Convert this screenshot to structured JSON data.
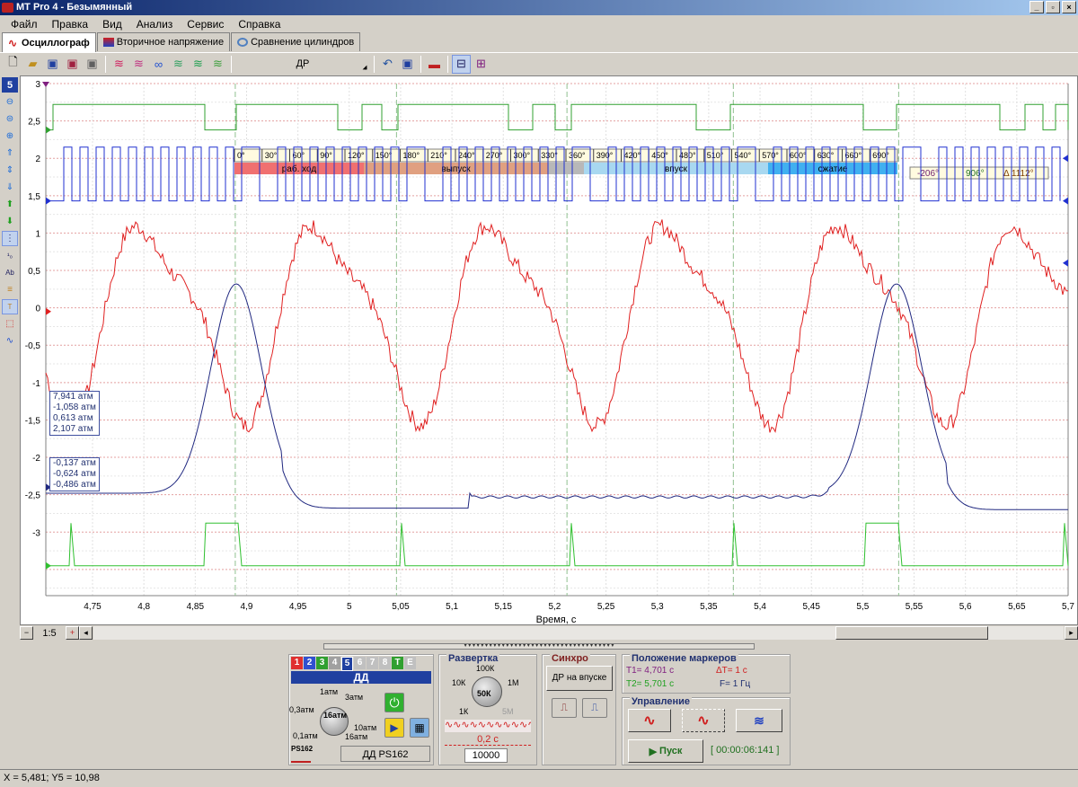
{
  "window": {
    "title": "MT Pro 4 - Безымянный",
    "min": "_",
    "max": "▫",
    "close": "×"
  },
  "menu": [
    "Файл",
    "Правка",
    "Вид",
    "Анализ",
    "Сервис",
    "Справка"
  ],
  "tabs": [
    {
      "label": "Осциллограф",
      "icon": "oscilloscope-icon"
    },
    {
      "label": "Вторичное напряжение",
      "icon": "secondary-voltage-icon"
    },
    {
      "label": "Сравнение цилиндров",
      "icon": "cylinders-compare-icon"
    }
  ],
  "toolbar": {
    "preset": "ДР"
  },
  "side": {
    "channel_num": "5"
  },
  "plot": {
    "y_ticks": [
      "3",
      "2,5",
      "2",
      "1,5",
      "1",
      "0,5",
      "0",
      "-0,5",
      "-1",
      "-1,5",
      "-2",
      "-2,5",
      "-3"
    ],
    "x_ticks": [
      "4,75",
      "4,8",
      "4,85",
      "4,9",
      "4,95",
      "5",
      "5,05",
      "5,1",
      "5,15",
      "5,2",
      "5,25",
      "5,3",
      "5,35",
      "5,4",
      "5,45",
      "5,5",
      "5,55",
      "5,6",
      "5,65",
      "5,7"
    ],
    "x_label": "Время, с",
    "degrees": [
      "0°",
      "30°",
      "60°",
      "90°",
      "120°",
      "150°",
      "180°",
      "210°",
      "240°",
      "270°",
      "300°",
      "330°",
      "360°",
      "390°",
      "420°",
      "450°",
      "480°",
      "510°",
      "540°",
      "570°",
      "600°",
      "630°",
      "660°",
      "690°"
    ],
    "phases": [
      {
        "label": "раб. ход",
        "color": "#f07070"
      },
      {
        "label": "выпуск",
        "color": "#e0a080"
      },
      {
        "label": "",
        "color": "#b8b8b8"
      },
      {
        "label": "впуск",
        "color": "#a8d8f0"
      },
      {
        "label": "сжатие",
        "color": "#40b0f0"
      }
    ],
    "angle_box": {
      "a1": "-206°",
      "a2": "906°",
      "delta": "Δ 1112°"
    },
    "stats1": [
      "7,941 атм",
      "-1,058 атм",
      "0,613 атм",
      "2,107 атм"
    ],
    "stats2": [
      "-0,137 атм",
      "-0,624 атм",
      "-0,486 атм"
    ]
  },
  "scroll": {
    "zoom": "1:5"
  },
  "channel_panel": {
    "tabs": [
      "1",
      "2",
      "3",
      "4",
      "5",
      "6",
      "7",
      "8",
      "T",
      "E"
    ],
    "tab_colors": [
      "#e03030",
      "#3050d0",
      "#30a030",
      "#a0a0a0",
      "#2040a0",
      "#c0c0c0",
      "#c0c0c0",
      "#c0c0c0",
      "#30a030",
      "#c0c0c0"
    ],
    "name": "ДД",
    "knob_labels": [
      "1атм",
      "3атм",
      "0,3атм",
      "16атм",
      "10атм",
      "0,1атм",
      "16атм"
    ],
    "sensor_icon": "PS162",
    "sensor": "ДД PS162"
  },
  "sweep": {
    "title": "Развертка",
    "labels": [
      "100К",
      "10К",
      "1М",
      "50К",
      "1К",
      "5М"
    ],
    "time": "0,2 с",
    "points": "10000"
  },
  "sync": {
    "title": "Синхро",
    "mode": "ДР на впуске"
  },
  "markers": {
    "title": "Положение маркеров",
    "t1": "T1= 4,701 с",
    "t2": "T2= 5,701 с",
    "dt": "ΔT= 1 с",
    "f": "F= 1 Гц"
  },
  "control": {
    "title": "Управление",
    "start": "Пуск",
    "timer": "[ 00:00:06:141 ]"
  },
  "status": {
    "text": "X = 5,481; Y5 = 10,98"
  }
}
